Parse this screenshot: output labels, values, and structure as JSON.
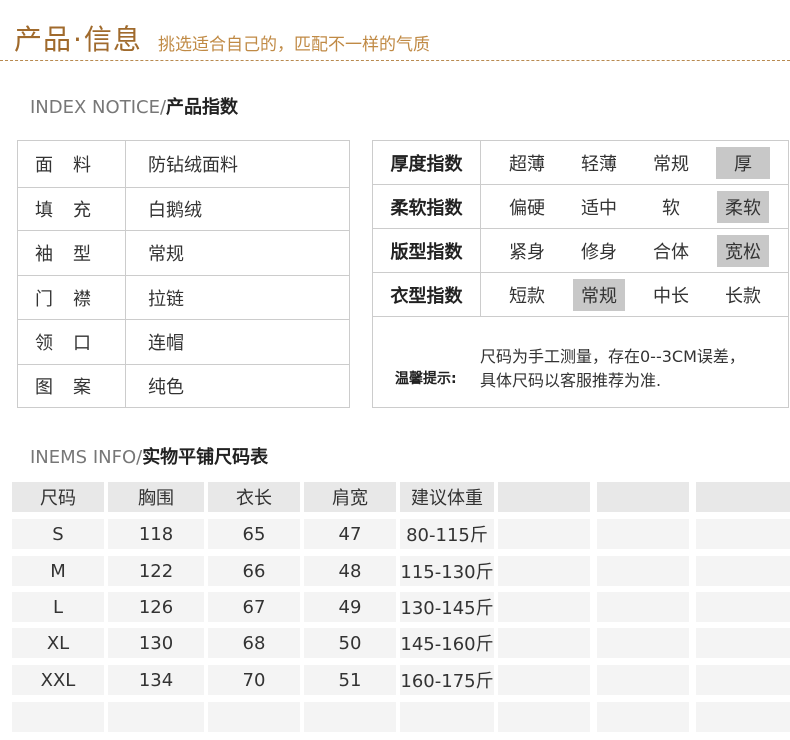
{
  "header": {
    "title_part1": "产品",
    "title_dot": "·",
    "title_part2": "信息",
    "subtitle": "挑选适合自己的，匹配不一样的气质"
  },
  "section1": {
    "prefix": "INDEX NOTICE/",
    "title": "产品指数"
  },
  "attributes": [
    {
      "key": "面料",
      "value": "防钻绒面料"
    },
    {
      "key": "填充",
      "value": "白鹅绒"
    },
    {
      "key": "袖型",
      "value": "常规"
    },
    {
      "key": "门襟",
      "value": "拉链"
    },
    {
      "key": "领口",
      "value": "连帽"
    },
    {
      "key": "图案",
      "value": "纯色"
    }
  ],
  "indices": [
    {
      "label": "厚度指数",
      "options": [
        "超薄",
        "轻薄",
        "常规",
        "厚"
      ],
      "selected": 3
    },
    {
      "label": "柔软指数",
      "options": [
        "偏硬",
        "适中",
        "软",
        "柔软"
      ],
      "selected": 3
    },
    {
      "label": "版型指数",
      "options": [
        "紧身",
        "修身",
        "合体",
        "宽松"
      ],
      "selected": 3
    },
    {
      "label": "衣型指数",
      "options": [
        "短款",
        "常规",
        "中长",
        "长款"
      ],
      "selected": 1
    }
  ],
  "tips": {
    "label": "温馨提示:",
    "line1": "尺码为手工测量，存在0--3CM误差，",
    "line2": "具体尺码以客服推荐为准."
  },
  "section2": {
    "prefix": "INEMS INFO/",
    "title": "实物平铺尺码表"
  },
  "size_table": {
    "headers": [
      "尺码",
      "胸围",
      "衣长",
      "肩宽",
      "建议体重",
      "",
      "",
      ""
    ],
    "rows": [
      [
        "S",
        "118",
        "65",
        "47",
        "80-115斤"
      ],
      [
        "M",
        "122",
        "66",
        "48",
        "115-130斤"
      ],
      [
        "L",
        "126",
        "67",
        "49",
        "130-145斤"
      ],
      [
        "XL",
        "130",
        "68",
        "50",
        "145-160斤"
      ],
      [
        "XXL",
        "134",
        "70",
        "51",
        "160-175斤"
      ]
    ]
  }
}
